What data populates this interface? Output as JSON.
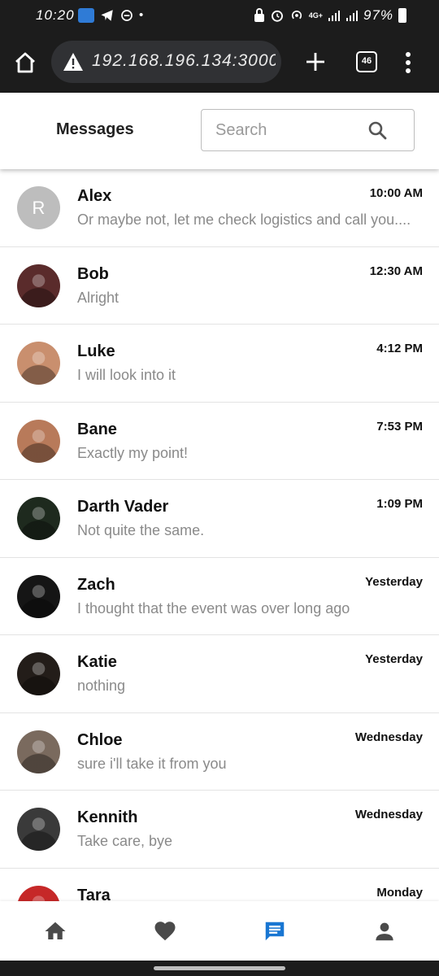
{
  "status_bar": {
    "time": "10:20",
    "battery": "97%",
    "network": "4G+"
  },
  "browser": {
    "url": "192.168.196.134:3000,",
    "tab_count": "46"
  },
  "header": {
    "title": "Messages",
    "search_placeholder": "Search"
  },
  "conversations": [
    {
      "name": "Alex",
      "preview": "Or maybe not, let me check logistics and call you....",
      "time": "10:00 AM",
      "avatar_letter": "R",
      "avatar_bg": "#bdbdbd"
    },
    {
      "name": "Bob",
      "preview": "Alright",
      "time": "12:30 AM",
      "avatar_bg": "#5a2b2b"
    },
    {
      "name": "Luke",
      "preview": "I will look into it",
      "time": "4:12 PM",
      "avatar_bg": "#c98f6e"
    },
    {
      "name": "Bane",
      "preview": "Exactly my point!",
      "time": "7:53 PM",
      "avatar_bg": "#b87a5a"
    },
    {
      "name": "Darth Vader",
      "preview": "Not quite the same.",
      "time": "1:09 PM",
      "avatar_bg": "#1e2a1e"
    },
    {
      "name": "Zach",
      "preview": "I thought that the event was over long ago",
      "time": "Yesterday",
      "avatar_bg": "#151515"
    },
    {
      "name": "Katie",
      "preview": "nothing",
      "time": "Yesterday",
      "avatar_bg": "#231d19"
    },
    {
      "name": "Chloe",
      "preview": "sure i'll take it from you",
      "time": "Wednesday",
      "avatar_bg": "#7a6a5e"
    },
    {
      "name": "Kennith",
      "preview": "Take care, bye",
      "time": "Wednesday",
      "avatar_bg": "#3a3a3a"
    },
    {
      "name": "Tara",
      "preview": "",
      "time": "Monday",
      "avatar_bg": "#c62828"
    }
  ],
  "bottom_nav": {
    "items": [
      {
        "icon": "home-icon",
        "active": false
      },
      {
        "icon": "heart-icon",
        "active": false
      },
      {
        "icon": "chat-icon",
        "active": true
      },
      {
        "icon": "person-icon",
        "active": false
      }
    ],
    "active_color": "#1976d2",
    "inactive_color": "#4a4a4a"
  }
}
